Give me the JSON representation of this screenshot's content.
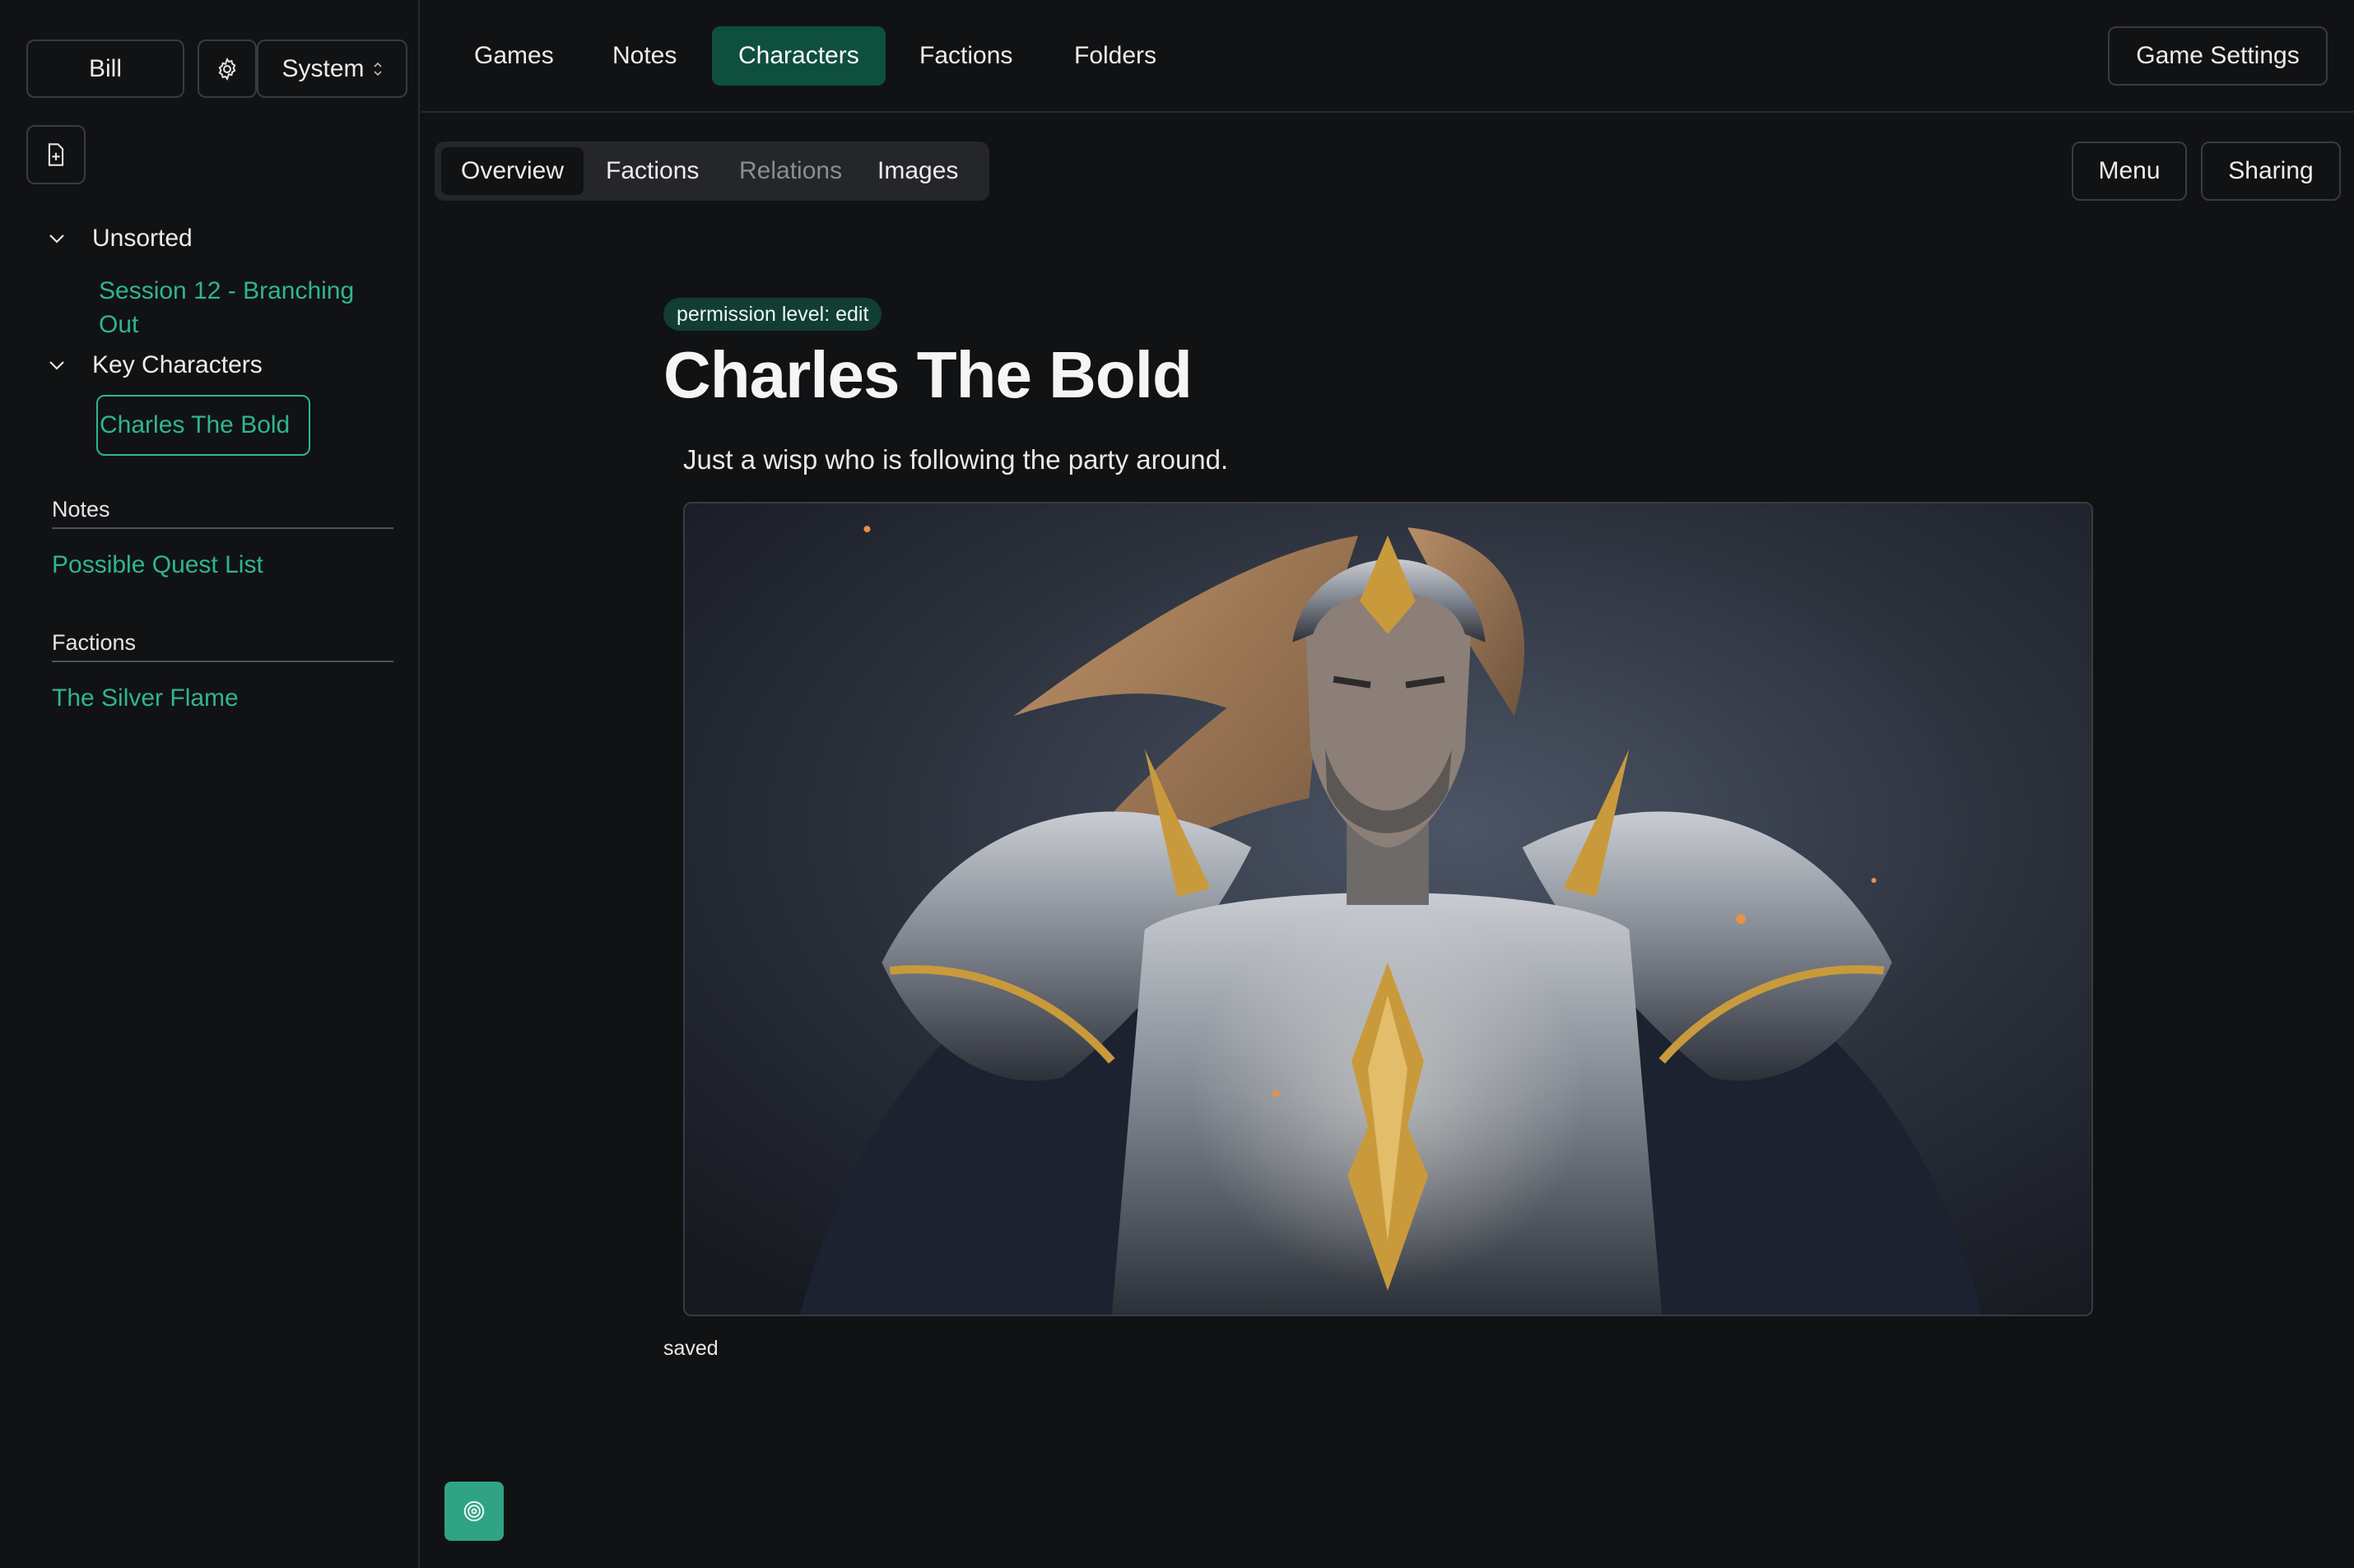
{
  "sidebar": {
    "user_label": "Bill",
    "theme_label": "System",
    "groups": [
      {
        "label": "Unsorted",
        "items": [
          {
            "label": "Session 12 - Branching Out"
          }
        ]
      },
      {
        "label": "Key Characters",
        "items": [
          {
            "label": "Charles The Bold"
          }
        ]
      }
    ],
    "notes": {
      "heading": "Notes",
      "items": [
        "Possible Quest List"
      ]
    },
    "factions": {
      "heading": "Factions",
      "items": [
        "The Silver Flame"
      ]
    }
  },
  "topnav": {
    "tabs": [
      {
        "label": "Games"
      },
      {
        "label": "Notes"
      },
      {
        "label": "Characters"
      },
      {
        "label": "Factions"
      },
      {
        "label": "Folders"
      }
    ],
    "active_tab": "Characters",
    "game_settings_label": "Game Settings"
  },
  "subnav": {
    "tabs": [
      {
        "label": "Overview"
      },
      {
        "label": "Factions"
      },
      {
        "label": "Relations"
      },
      {
        "label": "Images"
      }
    ],
    "active_tab": "Overview",
    "menu_label": "Menu",
    "sharing_label": "Sharing"
  },
  "character": {
    "permission_badge": "permission level: edit",
    "name": "Charles The Bold",
    "description": "Just a wisp who is following the party around.",
    "save_status": "saved"
  },
  "colors": {
    "background": "#111214",
    "accent": "#2fb592",
    "active_tab_bg": "#0f4f3e",
    "badge_bg": "#123d33"
  },
  "icons": {
    "settings": "gear-icon",
    "new_document": "file-plus-icon",
    "collapse": "chevron-down-icon",
    "theme_select": "chevron-up-down-icon",
    "fab": "target-icon"
  }
}
